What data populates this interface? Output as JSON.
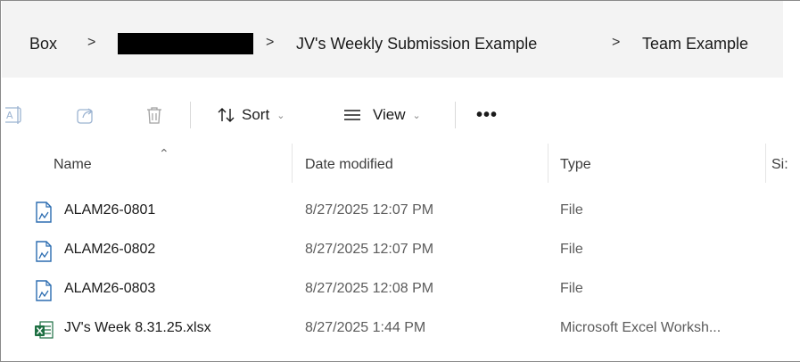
{
  "breadcrumb": {
    "items": [
      "Box",
      "JV's Weekly Submission Example",
      "Team Example"
    ],
    "separator": ">"
  },
  "toolbar": {
    "sort_label": "Sort",
    "view_label": "View",
    "more_label": "•••"
  },
  "columns": {
    "name": "Name",
    "date_modified": "Date modified",
    "type": "Type",
    "size_partial": "Si:"
  },
  "files": [
    {
      "name": "ALAM26-0801",
      "date": "8/27/2025 12:07 PM",
      "type": "File",
      "icon": "generic-file-icon"
    },
    {
      "name": "ALAM26-0802",
      "date": "8/27/2025 12:07 PM",
      "type": "File",
      "icon": "generic-file-icon"
    },
    {
      "name": "ALAM26-0803",
      "date": "8/27/2025 12:08 PM",
      "type": "File",
      "icon": "generic-file-icon"
    },
    {
      "name": "JV's Week 8.31.25.xlsx",
      "date": "8/27/2025 1:44 PM",
      "type": "Microsoft Excel Worksh...",
      "icon": "excel-file-icon"
    }
  ],
  "colors": {
    "breadcrumb_bg": "#f3f3f3",
    "excel_green": "#1d6f42",
    "file_icon_blue": "#2b6cb0",
    "secondary_text": "#5c5c5c"
  }
}
